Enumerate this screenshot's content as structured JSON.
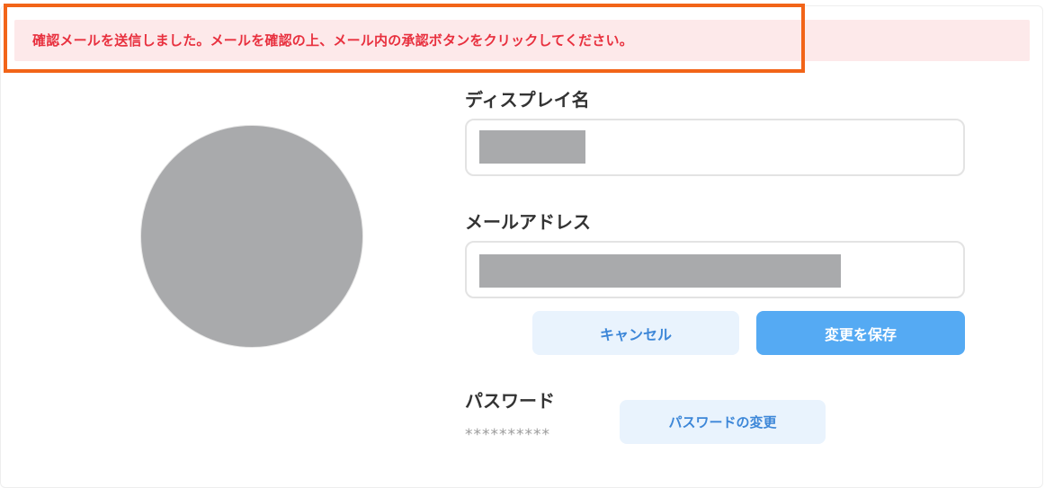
{
  "alert": {
    "message": "確認メールを送信しました。メールを確認の上、メール内の承認ボタンをクリックしてください。",
    "color": "#e8303e",
    "background": "#fde9ea",
    "highlight_color": "#f26418"
  },
  "profile": {
    "display_name_label": "ディスプレイ名",
    "display_name_value": "",
    "email_label": "メールアドレス",
    "email_value": ""
  },
  "actions": {
    "cancel_label": "キャンセル",
    "save_label": "変更を保存"
  },
  "password": {
    "label": "パスワード",
    "masked_value": "**********",
    "change_label": "パスワードの変更"
  },
  "colors": {
    "accent": "#55aaf3",
    "secondary_button_bg": "#e9f3fd",
    "secondary_button_text": "#3d87d8",
    "avatar_placeholder": "#a9aaac"
  }
}
